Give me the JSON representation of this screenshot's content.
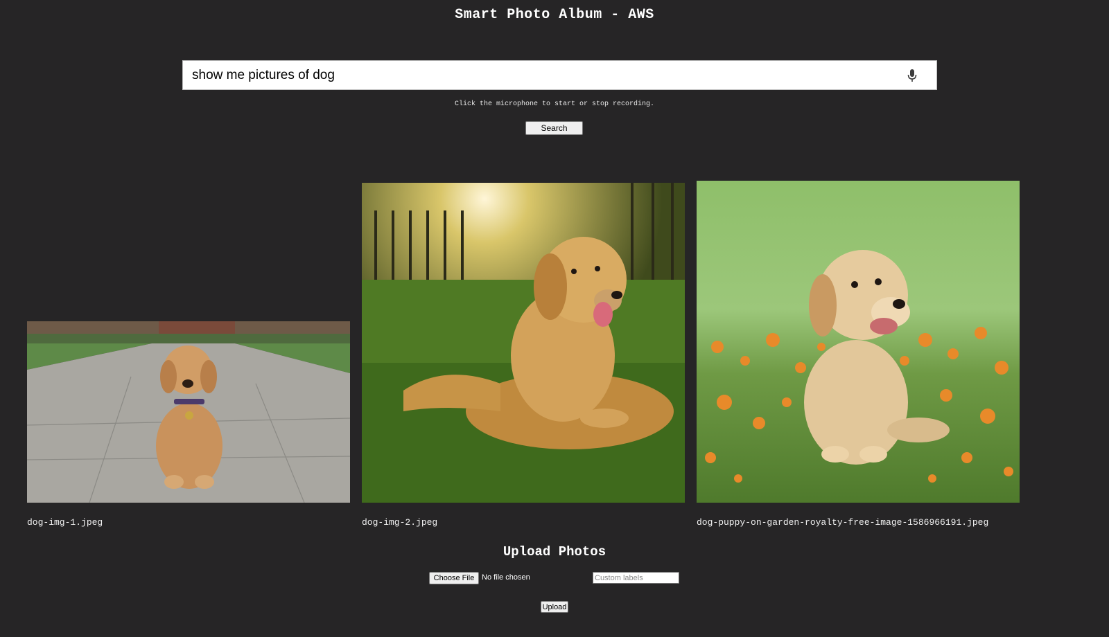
{
  "header": {
    "title": "Smart Photo Album - AWS"
  },
  "search": {
    "value": "show me pictures of dog",
    "placeholder": "",
    "hint": "Click the microphone to start or stop recording.",
    "button_label": "Search"
  },
  "results": [
    {
      "filename": "dog-img-1.jpeg"
    },
    {
      "filename": "dog-img-2.jpeg"
    },
    {
      "filename": "dog-puppy-on-garden-royalty-free-image-1586966191.jpeg"
    }
  ],
  "upload": {
    "title": "Upload Photos",
    "choose_label": "Choose File",
    "file_status": "No file chosen",
    "labels_placeholder": "Custom labels",
    "button_label": "Upload"
  },
  "colors": {
    "background": "#262526",
    "text": "#ffffff"
  }
}
